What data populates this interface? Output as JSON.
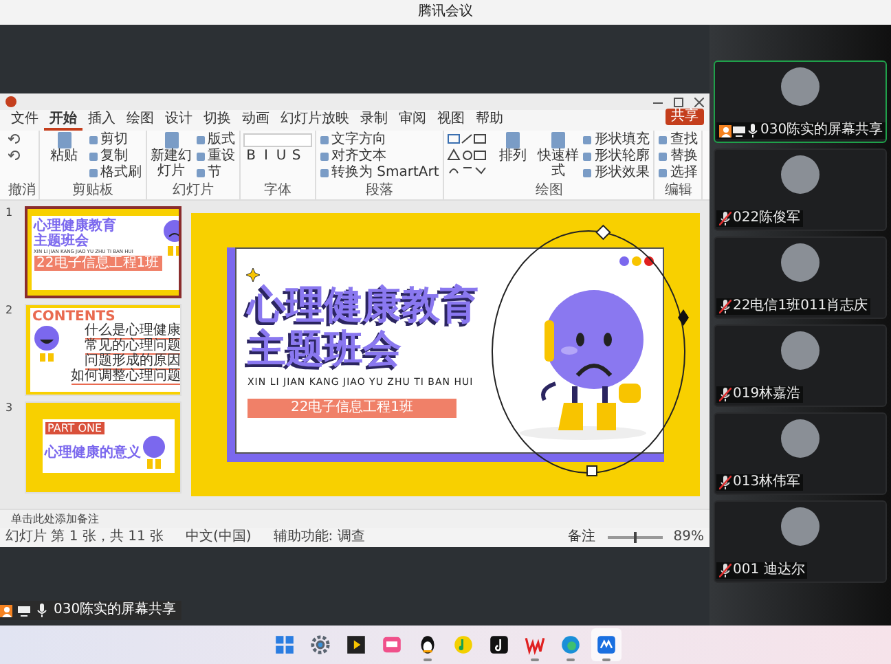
{
  "window": {
    "title": "腾讯会议"
  },
  "ppt": {
    "tabs": [
      {
        "label": "文件",
        "selected": false
      },
      {
        "label": "开始",
        "selected": true
      },
      {
        "label": "插入",
        "selected": false
      },
      {
        "label": "绘图",
        "selected": false
      },
      {
        "label": "设计",
        "selected": false
      },
      {
        "label": "切换",
        "selected": false
      },
      {
        "label": "动画",
        "selected": false
      },
      {
        "label": "幻灯片放映",
        "selected": false
      },
      {
        "label": "录制",
        "selected": false
      },
      {
        "label": "审阅",
        "selected": false
      },
      {
        "label": "视图",
        "selected": false
      },
      {
        "label": "帮助",
        "selected": false
      }
    ],
    "share_button": "共享",
    "ribbon_groups": [
      {
        "label": "撤消",
        "items": [
          {
            "kind": "icon"
          },
          {
            "kind": "icon"
          }
        ]
      },
      {
        "label": "剪贴板",
        "items": [
          {
            "kind": "large",
            "label": "粘贴"
          },
          {
            "kind": "small",
            "label": "剪切"
          },
          {
            "kind": "small",
            "label": "复制"
          },
          {
            "kind": "small",
            "label": "格式刷"
          }
        ]
      },
      {
        "label": "幻灯片",
        "items": [
          {
            "kind": "large",
            "label": "新建幻灯片"
          },
          {
            "kind": "small",
            "label": "版式"
          },
          {
            "kind": "small",
            "label": "重设"
          },
          {
            "kind": "small",
            "label": "节"
          }
        ]
      },
      {
        "label": "字体",
        "items": [
          {
            "kind": "field"
          },
          {
            "kind": "glyphs",
            "letters": [
              "B",
              "I",
              "U",
              "S"
            ]
          }
        ]
      },
      {
        "label": "段落",
        "items": [
          {
            "kind": "small",
            "label": "文字方向"
          },
          {
            "kind": "small",
            "label": "对齐文本"
          },
          {
            "kind": "small",
            "label": "转换为 SmartArt"
          }
        ]
      },
      {
        "label": "绘图",
        "items": [
          {
            "kind": "gallery"
          },
          {
            "kind": "large",
            "label": "排列"
          },
          {
            "kind": "large",
            "label": "快速样式"
          },
          {
            "kind": "small",
            "label": "形状填充"
          },
          {
            "kind": "small",
            "label": "形状轮廓"
          },
          {
            "kind": "small",
            "label": "形状效果"
          }
        ]
      },
      {
        "label": "编辑",
        "items": [
          {
            "kind": "small",
            "label": "查找"
          },
          {
            "kind": "small",
            "label": "替换"
          },
          {
            "kind": "small",
            "label": "选择"
          }
        ]
      }
    ],
    "thumbnails": [
      {
        "number": "1",
        "kind": "title",
        "selected": true,
        "title_lines": [
          "心理健康教育",
          "主题班会"
        ],
        "pinyin": "XIN LI JIAN KANG JIAO YU ZHU TI BAN HUI",
        "band": "22电子信息工程1班"
      },
      {
        "number": "2",
        "kind": "contents",
        "selected": false,
        "heading": "CONTENTS",
        "entries": [
          "什么是心理健康",
          "常见的心理问题",
          "问题形成的原因",
          "如何调整心理问题"
        ]
      },
      {
        "number": "3",
        "kind": "part",
        "selected": false,
        "tag": "PART ONE",
        "heading": "心理健康的意义"
      }
    ],
    "slide": {
      "title_lines": [
        "心理健康教育",
        "主题班会"
      ],
      "pinyin": "XIN LI JIAN KANG JIAO YU ZHU TI BAN HUI",
      "band": "22电子信息工程1班"
    },
    "notes_placeholder": "单击此处添加备注",
    "status_bar": {
      "slide_position": "幻灯片 第 1 张，共 11 张",
      "language": "中文(中国)",
      "accessibility": "辅助功能: 调查",
      "notes_button": "备注",
      "zoom": "89%",
      "zoom_slider": {
        "level": 0.5
      }
    }
  },
  "participants": [
    {
      "name": "030陈实的屏幕共享",
      "selected": true,
      "muted": false,
      "sharing": true
    },
    {
      "name": "022陈俊军",
      "selected": false,
      "muted": true,
      "sharing": false
    },
    {
      "name": "22电信1班011肖志庆",
      "selected": false,
      "muted": true,
      "sharing": false
    },
    {
      "name": "019林嘉浩",
      "selected": false,
      "muted": true,
      "sharing": false
    },
    {
      "name": "013林伟军",
      "selected": false,
      "muted": true,
      "sharing": false
    },
    {
      "name": "001 迪达尔",
      "selected": false,
      "muted": true,
      "sharing": false
    }
  ],
  "share_label": {
    "name": "030陈实的屏幕共享",
    "muted": false,
    "sharing": true
  },
  "taskbar": [
    {
      "kind": "start",
      "running": false,
      "selected": false
    },
    {
      "kind": "settings",
      "running": false,
      "selected": false
    },
    {
      "kind": "player",
      "running": false,
      "selected": false
    },
    {
      "kind": "pink",
      "running": false,
      "selected": false
    },
    {
      "kind": "penguin",
      "running": true,
      "selected": false
    },
    {
      "kind": "music",
      "running": false,
      "selected": false
    },
    {
      "kind": "note",
      "running": false,
      "selected": false
    },
    {
      "kind": "wps",
      "running": true,
      "selected": false
    },
    {
      "kind": "edge",
      "running": true,
      "selected": false
    },
    {
      "kind": "meeting",
      "running": true,
      "selected": true
    }
  ]
}
